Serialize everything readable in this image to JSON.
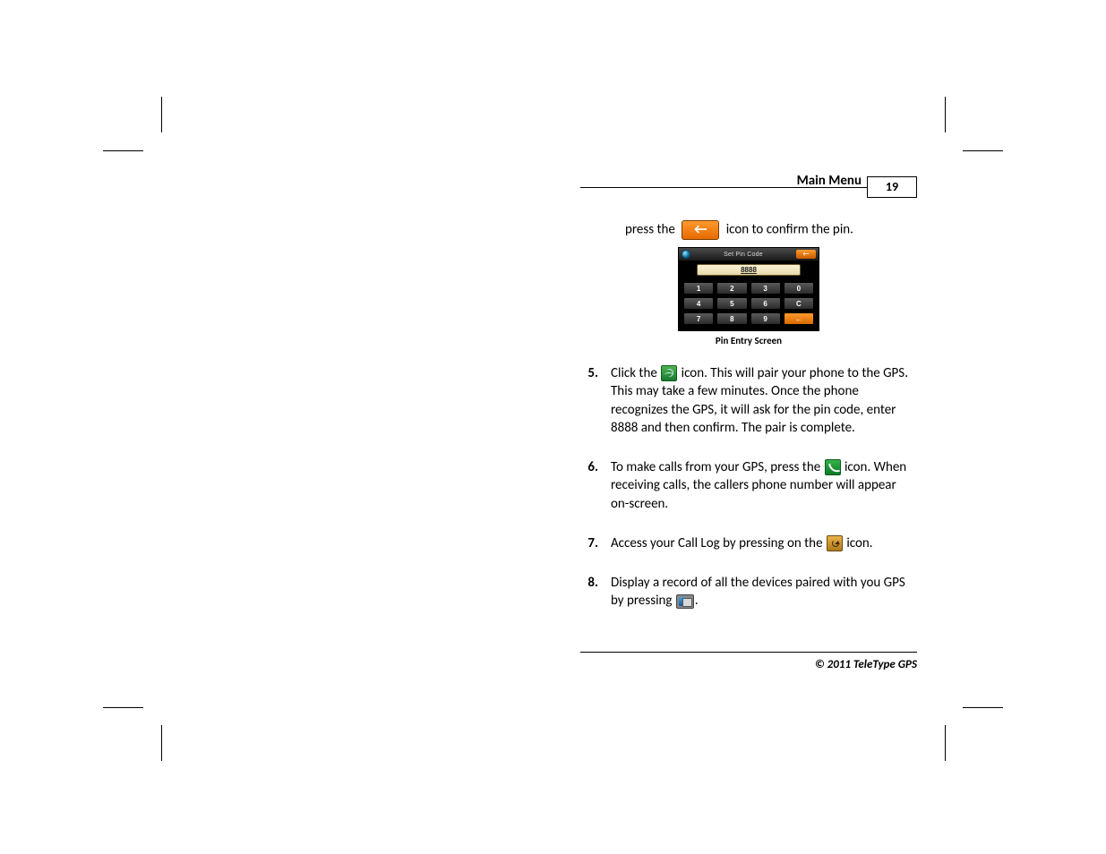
{
  "header": {
    "title": "Main Menu",
    "page_number": "19"
  },
  "intro": {
    "before": "press the",
    "after": "icon to confirm the pin."
  },
  "pin_screen": {
    "title": "Set Pin Code",
    "value": "8888",
    "keys": [
      "1",
      "2",
      "3",
      "0",
      "4",
      "5",
      "6",
      "C",
      "7",
      "8",
      "9",
      ""
    ],
    "caption": "Pin Entry Screen"
  },
  "steps": [
    {
      "num": "5.",
      "before": "Click the",
      "after": "icon. This will pair your phone to the GPS. This may take a few minutes. Once the phone recognizes the GPS, it will ask for the pin code, enter 8888 and then confirm. The pair is complete.",
      "icon": "bluetooth"
    },
    {
      "num": "6.",
      "before": "To make calls from your GPS, press the",
      "after": "icon. When receiving calls, the callers phone number will appear on-screen.",
      "icon": "phone"
    },
    {
      "num": "7.",
      "before": "Access  your Call Log by pressing on the",
      "after": "icon.",
      "icon": "call-log"
    },
    {
      "num": "8.",
      "before": "Display a record of all the devices paired with you GPS by pressing",
      "after": ".",
      "icon": "devices"
    }
  ],
  "footer": "© 2011 TeleType GPS"
}
